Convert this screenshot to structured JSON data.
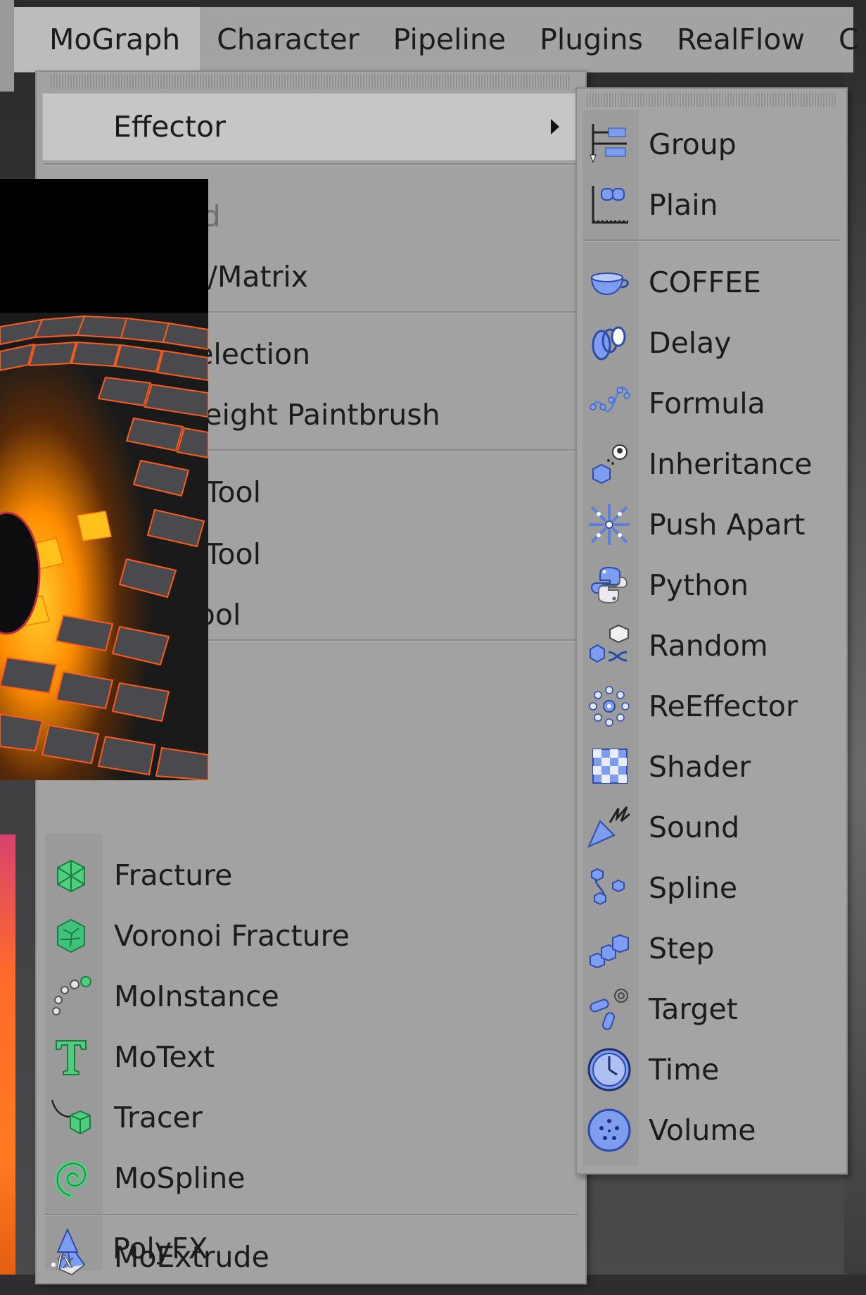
{
  "menubar": {
    "tabs": [
      "MoGraph",
      "Character",
      "Pipeline",
      "Plugins",
      "RealFlow",
      "C"
    ]
  },
  "main_menu": {
    "items": [
      {
        "label": "Effector",
        "icon": "effector-submenu",
        "has_submenu": true,
        "highlighted": true
      },
      {
        "label": "elected",
        "icon": "none",
        "disabled": true
      },
      {
        "label": "Cloner/Matrix",
        "icon": "none"
      },
      {
        "label": "aph Selection",
        "icon": "none"
      },
      {
        "label": "aph Weight Paintbrush",
        "icon": "none"
      },
      {
        "label": "Clone Tool",
        "icon": "none"
      },
      {
        "label": "Clone Tool",
        "icon": "none"
      },
      {
        "label": "lone Tool",
        "icon": "none"
      },
      {
        "label": "Fracture",
        "icon": "fracture-icon"
      },
      {
        "label": "Voronoi Fracture",
        "icon": "voronoi-fracture-icon"
      },
      {
        "label": "MoInstance",
        "icon": "moinstance-icon"
      },
      {
        "label": "MoText",
        "icon": "motext-icon"
      },
      {
        "label": "Tracer",
        "icon": "tracer-icon"
      },
      {
        "label": "MoSpline",
        "icon": "mospline-icon"
      },
      {
        "label": "MoExtrude",
        "icon": "moextrude-icon"
      },
      {
        "label": "PolyFX",
        "icon": "polyfx-icon"
      }
    ]
  },
  "effector_submenu": {
    "items": [
      {
        "label": "Group",
        "icon": "group-icon"
      },
      {
        "label": "Plain",
        "icon": "plain-icon"
      },
      {
        "label": "COFFEE",
        "icon": "coffee-icon"
      },
      {
        "label": "Delay",
        "icon": "delay-icon"
      },
      {
        "label": "Formula",
        "icon": "formula-icon"
      },
      {
        "label": "Inheritance",
        "icon": "inheritance-icon"
      },
      {
        "label": "Push Apart",
        "icon": "push-apart-icon"
      },
      {
        "label": "Python",
        "icon": "python-icon"
      },
      {
        "label": "Random",
        "icon": "random-icon"
      },
      {
        "label": "ReEffector",
        "icon": "reeffector-icon"
      },
      {
        "label": "Shader",
        "icon": "shader-icon"
      },
      {
        "label": "Sound",
        "icon": "sound-icon"
      },
      {
        "label": "Spline",
        "icon": "spline-icon"
      },
      {
        "label": "Step",
        "icon": "step-icon"
      },
      {
        "label": "Target",
        "icon": "target-icon"
      },
      {
        "label": "Time",
        "icon": "time-icon"
      },
      {
        "label": "Volume",
        "icon": "volume-icon"
      }
    ]
  },
  "colors": {
    "menu_bg": "#a2a2a2",
    "highlight": "#c6c6c6",
    "generator_icon_green": "#4fcf7e",
    "effector_icon_blue": "#5a7fe0",
    "photo_glow": "#ff8a00"
  }
}
